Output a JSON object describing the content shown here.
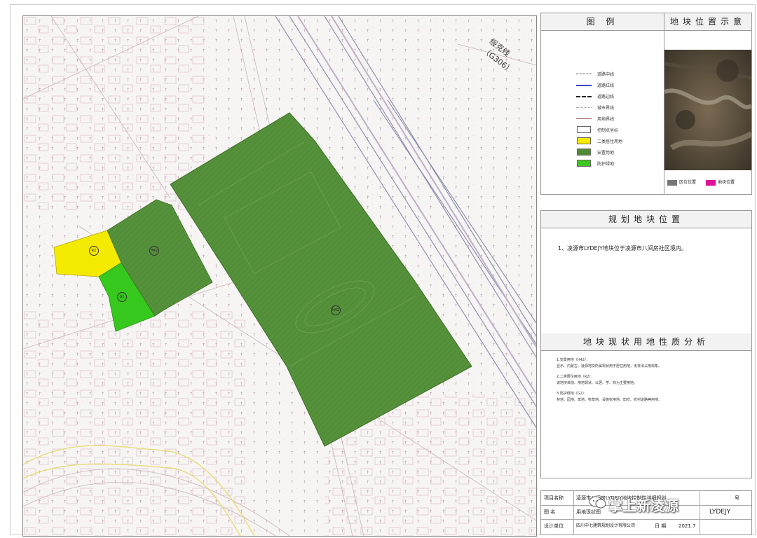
{
  "map": {
    "road_label": "绥克线（G306）",
    "parcel_labels": {
      "residential": "R2",
      "park": "G1",
      "resettle_small": "H42",
      "resettle_large": "H42"
    }
  },
  "legend": {
    "title": "图    例",
    "items": [
      {
        "label": "道路中线",
        "symbol": "dash-dot-line"
      },
      {
        "label": "道路红线",
        "symbol": "blue-line"
      },
      {
        "label": "道路边线",
        "symbol": "dash-line"
      },
      {
        "label": "城市界线",
        "symbol": "thin-dash-line"
      },
      {
        "label": "用地界线",
        "symbol": "brown-line"
      },
      {
        "label": "控制点坐标",
        "symbol": "white-box"
      },
      {
        "label": "二类居住用地",
        "symbol": "yellow-box",
        "color": "#ffeb00"
      },
      {
        "label": "安置用地",
        "symbol": "darkgreen-box",
        "color": "#4f8a36"
      },
      {
        "label": "防护绿地",
        "symbol": "green-box",
        "color": "#3ec71f"
      }
    ]
  },
  "location_map": {
    "title": "地块位置示意",
    "legend": [
      {
        "label": "区位位置",
        "color": "#777777"
      },
      {
        "label": "地块位置",
        "color": "#e0119a"
      }
    ]
  },
  "planning_location": {
    "title": "规划地块位置",
    "text": "1、凌源市LYDEJY地块位于凌源市八间房社区境内。"
  },
  "analysis": {
    "title": "地块现状用地性质分析",
    "paragraphs": [
      "1.安置用地（H42）：",
      "显示、内蒙古、凌源地块所属现状用于居住用地，无非法占用现象。",
      "2.二类居住用地（R2）：",
      "该地块目前、用地现状、以居、学、商为主要用地。",
      "3.防护绿地（G2）：",
      "林地、园地、草地、牧草地、设施农用地、田坎、农村道路等用地。"
    ]
  },
  "title_block": {
    "project_label": "项目名称",
    "project_value": "凌源市八间房LYDEJY地块控制性详细规划",
    "drawing_label": "图    名",
    "drawing_value": "用地现状图",
    "designer_label": "设计单位",
    "designer_value": "四川中七建筑规划设计有限公司",
    "date_label": "日    期",
    "date_value": "2021.7",
    "code_label": "号",
    "code_value": "LYDEJY"
  },
  "watermark": "掌上新凌源"
}
